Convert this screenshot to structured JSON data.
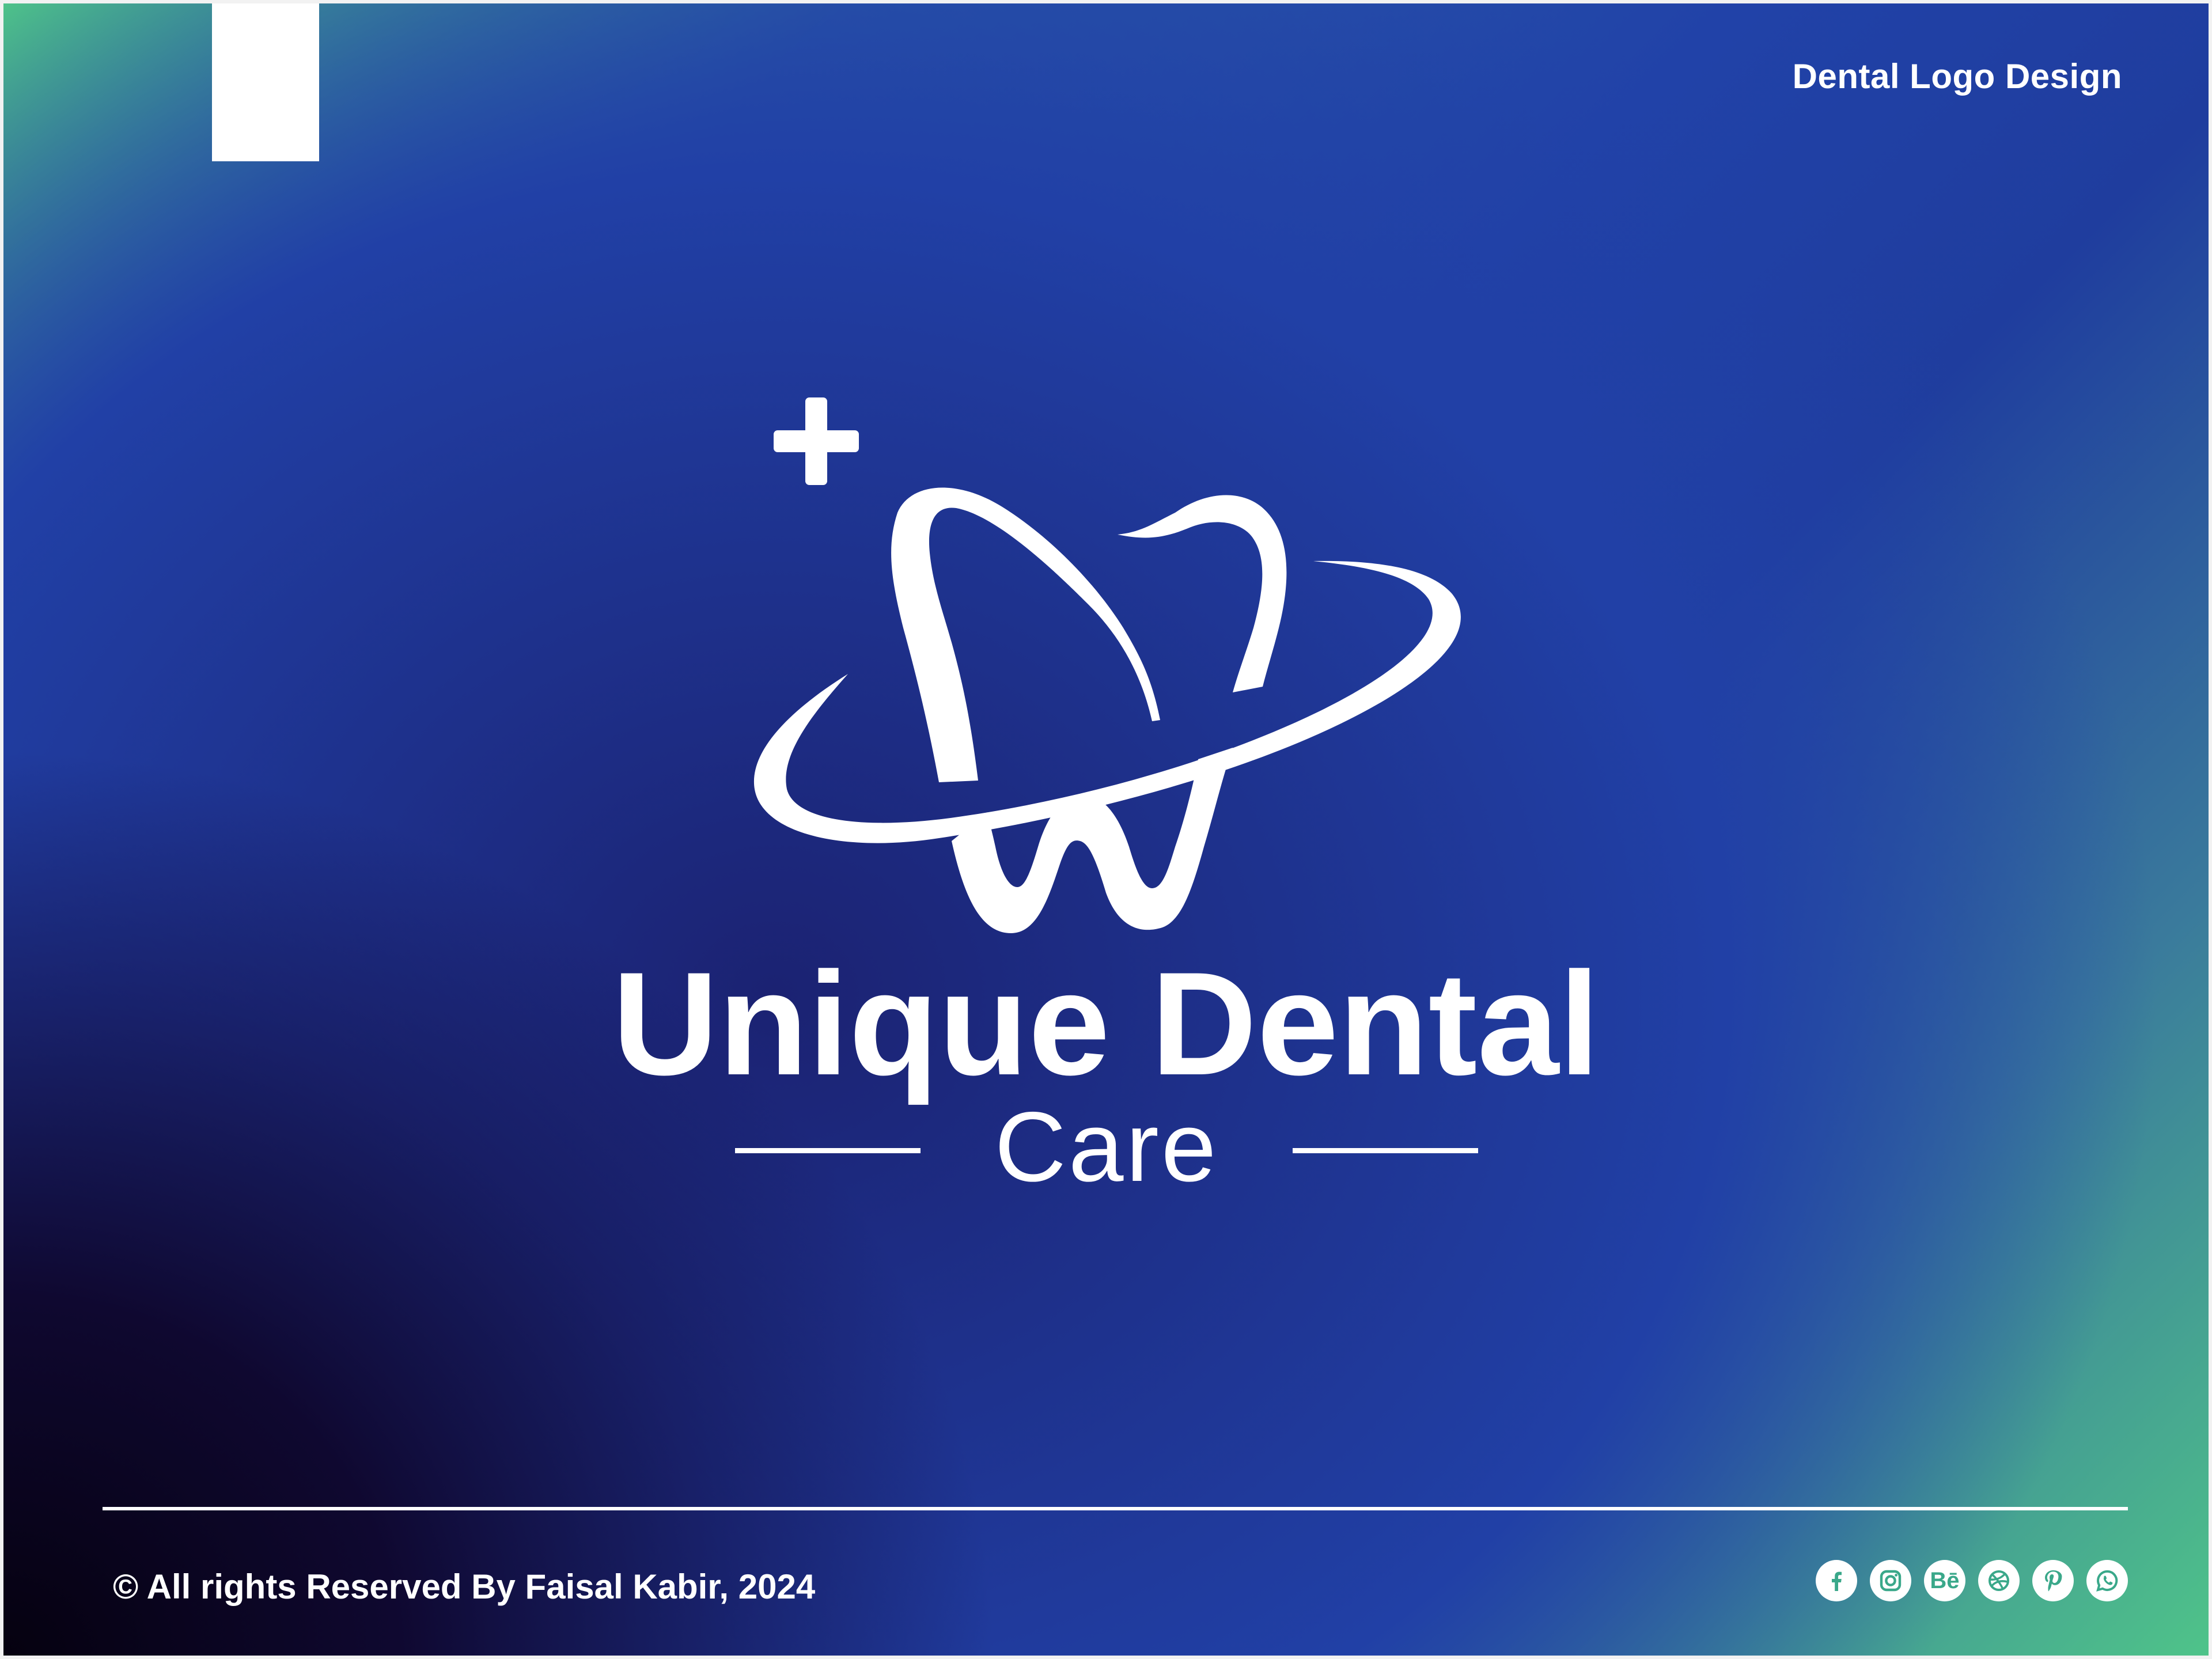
{
  "header": {
    "title": "Dental Logo Design"
  },
  "logo": {
    "icon": "tooth-with-orbit-and-plus-icon",
    "brand_name": "Unique Dental",
    "tagline": "Care"
  },
  "footer": {
    "copyright": "© All rights Reserved By Faisal Kabir, 2024",
    "socials": [
      {
        "icon": "facebook-icon"
      },
      {
        "icon": "instagram-icon"
      },
      {
        "icon": "behance-icon",
        "glyph": "Bē"
      },
      {
        "icon": "dribbble-icon"
      },
      {
        "icon": "pinterest-icon"
      },
      {
        "icon": "whatsapp-icon"
      }
    ]
  },
  "colors": {
    "accent_green": "#4fc489",
    "deep_blue": "#2142a8",
    "dark_navy": "#0a0420",
    "white": "#ffffff"
  }
}
